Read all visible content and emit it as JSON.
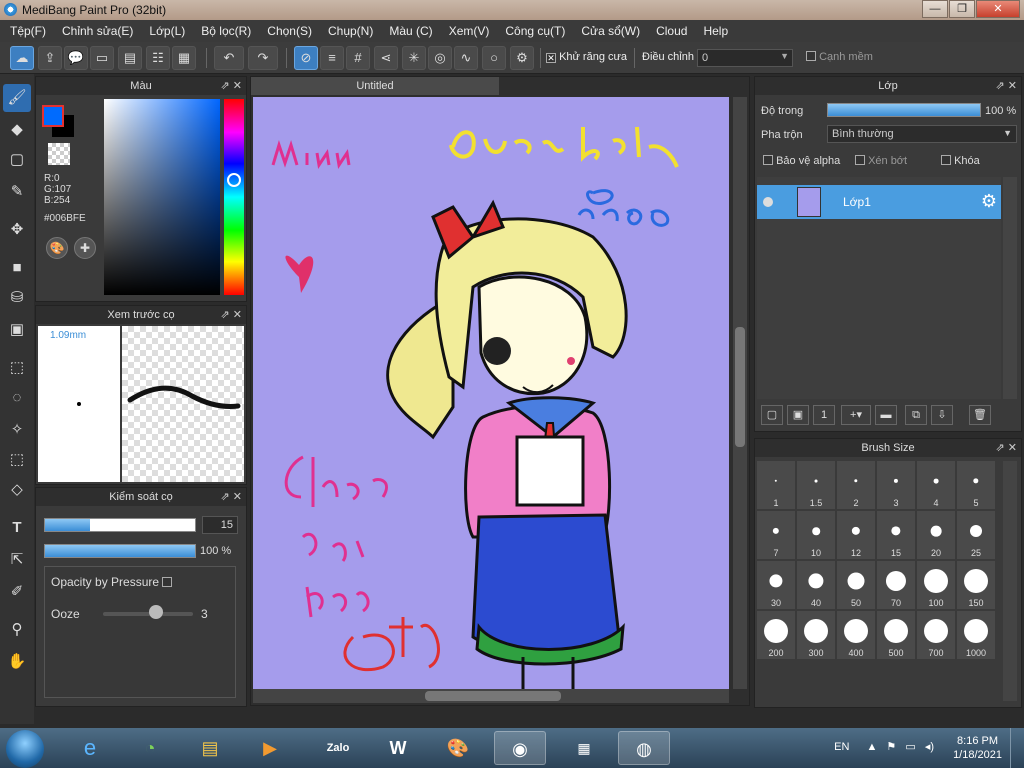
{
  "window": {
    "title": "MediBang Paint Pro (32bit)",
    "min": "—",
    "max": "❐",
    "close": "✕"
  },
  "menu": [
    "Tệp(F)",
    "Chỉnh sửa(E)",
    "Lớp(L)",
    "Bộ lọc(R)",
    "Chọn(S)",
    "Chụp(N)",
    "Màu (C)",
    "Xem(V)",
    "Công cụ(T)",
    "Cửa sổ(W)",
    "Cloud",
    "Help"
  ],
  "toolbar": {
    "antialias_label": "Khử răng cưa",
    "adjust_label": "Điều chỉnh",
    "adjust_value": "0",
    "soft_edge_label": "Cạnh mềm",
    "antialias_checked": "✕"
  },
  "color_panel": {
    "title": "Màu",
    "r": "R:0",
    "g": "G:107",
    "b": "B:254",
    "hex": "#006BFE",
    "fg_color": "#006bfe"
  },
  "preview_panel": {
    "title": "Xem trước cọ",
    "size": "1.09mm"
  },
  "brush_panel": {
    "title": "Kiểm soát cọ",
    "size_value": "15",
    "opacity_value": "100 %",
    "size_fraction": 0.3,
    "opacity_fraction": 1.0,
    "pressure_label": "Opacity by Pressure",
    "ooze_label": "Ooze",
    "ooze_value": "3"
  },
  "canvas": {
    "tab": "Untitled"
  },
  "layer_panel": {
    "title": "Lớp",
    "opacity_label": "Độ trong",
    "opacity_value": "100 %",
    "blend_label": "Pha trộn",
    "blend_value": "Bình thường",
    "protect_alpha": "Bảo vệ alpha",
    "clipping": "Xén bớt",
    "lock": "Khóa",
    "layer_name": "Lớp1"
  },
  "brush_size_panel": {
    "title": "Brush Size",
    "sizes": [
      "1",
      "1.5",
      "2",
      "3",
      "4",
      "5",
      "7",
      "10",
      "12",
      "15",
      "20",
      "25",
      "30",
      "40",
      "50",
      "70",
      "100",
      "150",
      "200",
      "300",
      "400",
      "500",
      "700",
      "1000"
    ]
  },
  "taskbar": {
    "lang": "EN",
    "time": "8:16 PM",
    "date": "1/18/2021",
    "zalo": "Zalo",
    "word": "W"
  }
}
